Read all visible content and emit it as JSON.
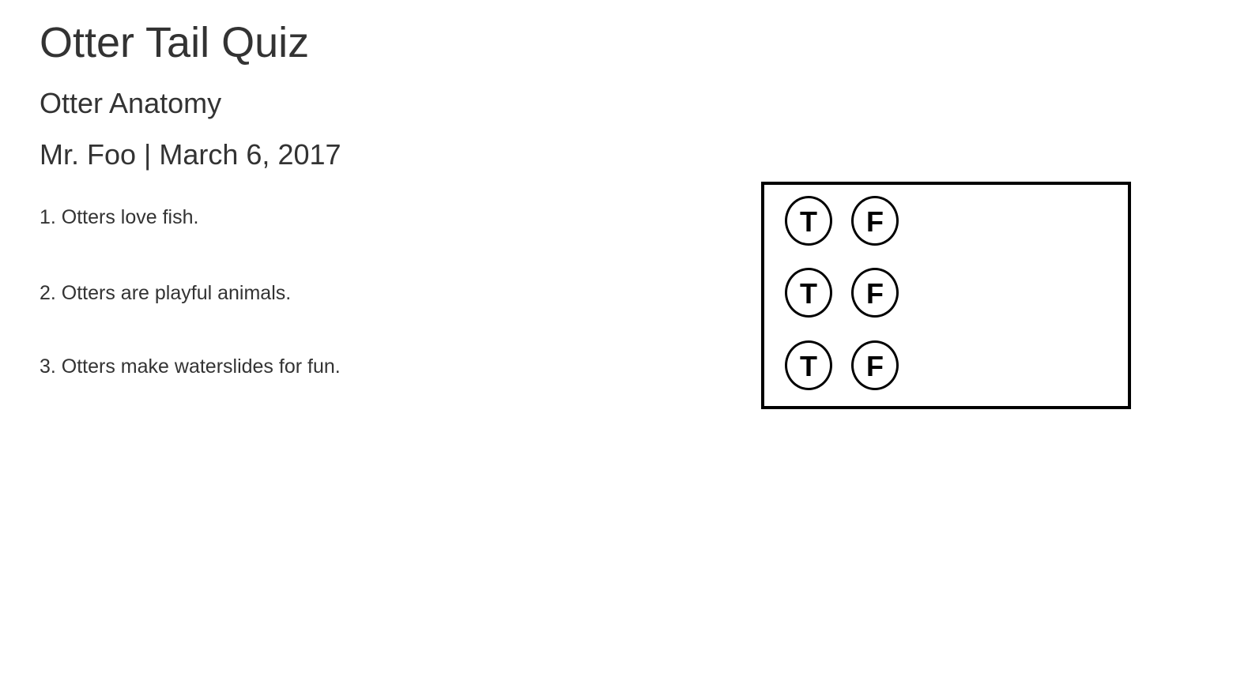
{
  "quiz": {
    "title": "Otter Tail Quiz",
    "subject": "Otter Anatomy",
    "teacher": "Mr. Foo",
    "separator": "|",
    "date": "March 6, 2017"
  },
  "questions": [
    {
      "text": "1. Otters love fish.",
      "true_label": "T",
      "false_label": "F"
    },
    {
      "text": "2. Otters are playful animals.",
      "true_label": "T",
      "false_label": "F"
    },
    {
      "text": "3. Otters make waterslides for fun.",
      "true_label": "T",
      "false_label": "F"
    }
  ]
}
